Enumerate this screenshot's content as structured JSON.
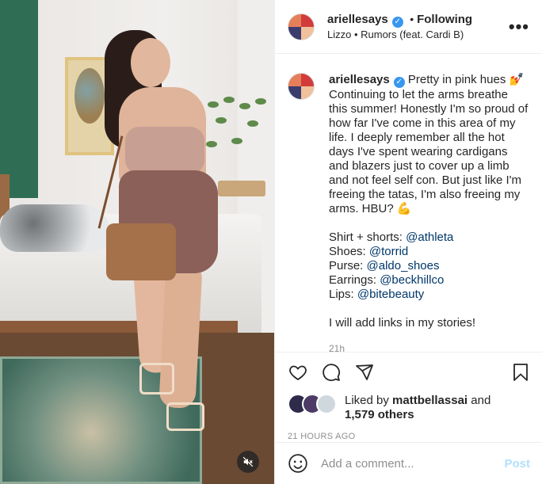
{
  "header": {
    "username": "ariellesays",
    "follow_separator": "•",
    "follow_label": "Following",
    "audio": "Lizzo • Rumors (feat. Cardi B)",
    "more_label": "•••"
  },
  "caption": {
    "username": "ariellesays",
    "lines": [
      "Pretty in pink hues 💅",
      "Continuing to let the arms breathe this summer! Honestly I'm so proud of how far I've come in this area of my life. I deeply remember all the hot days I've spent wearing cardigans and blazers just to cover up a limb and not feel self con. But just like I'm freeing the tatas, I'm also freeing my arms. HBU? 💪"
    ],
    "credits": [
      {
        "label": "Shirt + shorts: ",
        "handle": "@athleta"
      },
      {
        "label": "Shoes: ",
        "handle": "@torrid"
      },
      {
        "label": "Purse: ",
        "handle": "@aldo_shoes"
      },
      {
        "label": "Earrings: ",
        "handle": "@beckhillco"
      },
      {
        "label": "Lips: ",
        "handle": "@bitebeauty"
      }
    ],
    "closing": "I will add links in my stories!",
    "time": "21h"
  },
  "likes": {
    "prefix": "Liked by ",
    "user": "mattbellassai",
    "and": " and",
    "others": "1,579 others"
  },
  "timestamp": "21 HOURS AGO",
  "comment": {
    "placeholder": "Add a comment...",
    "post_label": "Post"
  },
  "colors": {
    "link": "#00376b",
    "verified": "#3897f0",
    "muted": "#8e8e8e",
    "post_disabled": "#b2dffc"
  },
  "icons": [
    "heart-icon",
    "comment-icon",
    "share-icon",
    "bookmark-icon",
    "emoji-icon",
    "mute-icon",
    "verified-icon"
  ]
}
